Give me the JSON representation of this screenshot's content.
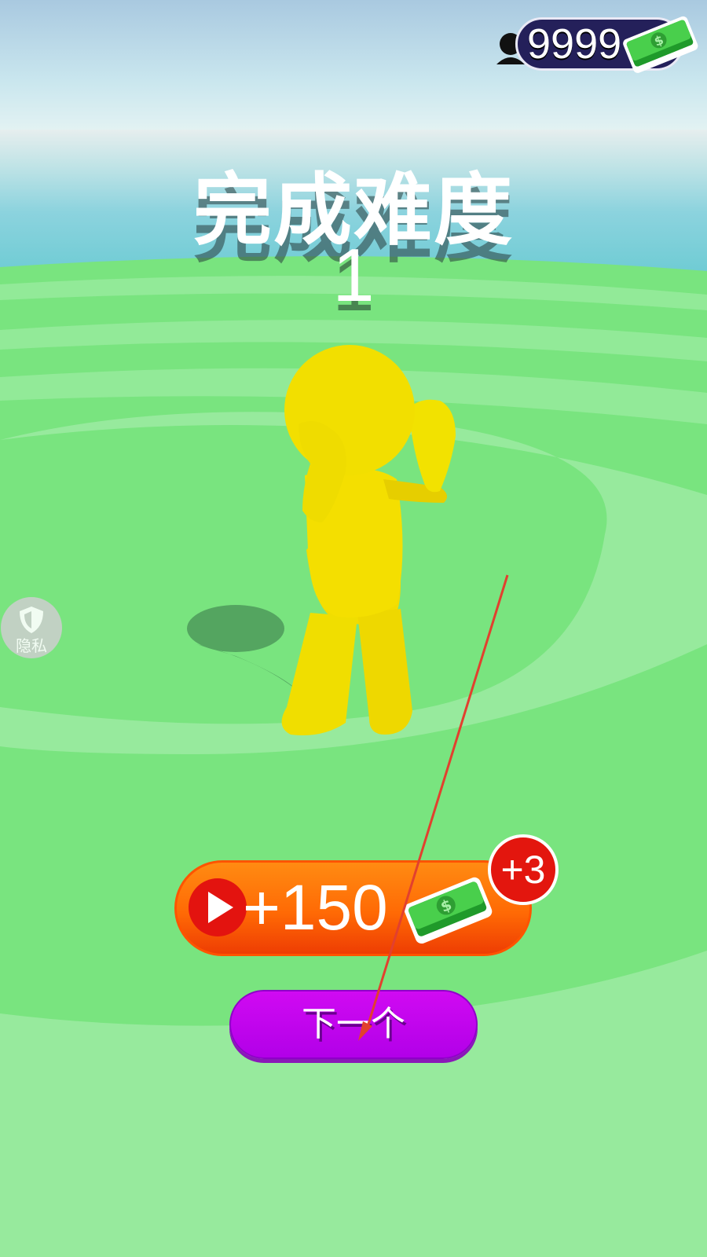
{
  "hud": {
    "coin_value": "9999",
    "cs_icon": "headset-icon",
    "cash_icon": "cash-icon"
  },
  "result": {
    "title": "完成难度",
    "level": "1"
  },
  "privacy": {
    "label": "隐私",
    "icon": "shield-icon"
  },
  "reward": {
    "label": "+150",
    "badge": "+3",
    "play_icon": "play-icon",
    "cash_icon": "cash-icon"
  },
  "next": {
    "label": "下一个"
  },
  "colors": {
    "accent_orange": "#ff6a05",
    "button_purple": "#c000ee",
    "badge_red": "#e3160e",
    "counter_bg": "#24205a",
    "ground_green": "#97ea9d"
  }
}
